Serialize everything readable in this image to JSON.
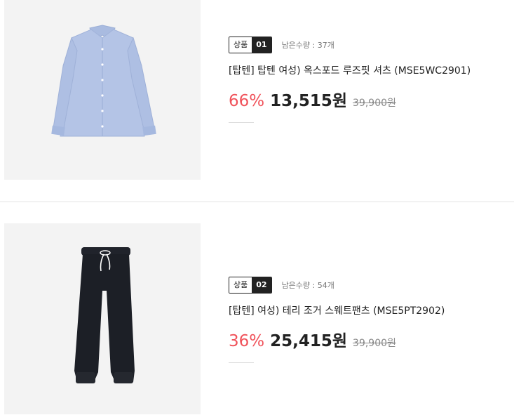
{
  "products": [
    {
      "badge_label": "상품",
      "badge_num": "01",
      "stock": "남은수량 : 37개",
      "title": "[탑텐] 탑텐 여성) 옥스포드 루즈핏 셔츠 (MSE5WC2901)",
      "discount": "66%",
      "price": "13,515원",
      "original_price": "39,900원",
      "image_icon": "shirt-icon"
    },
    {
      "badge_label": "상품",
      "badge_num": "02",
      "stock": "남은수량 : 54개",
      "title": "[탑텐] 여성) 테리 조거 스웨트팬츠 (MSE5PT2902)",
      "discount": "36%",
      "price": "25,415원",
      "original_price": "39,900원",
      "image_icon": "pants-icon"
    }
  ],
  "colors": {
    "discount": "#f0525a",
    "shirt": "#b4c4e6",
    "pants": "#1c1f26",
    "thumb_bg": "#f3f3f3"
  }
}
